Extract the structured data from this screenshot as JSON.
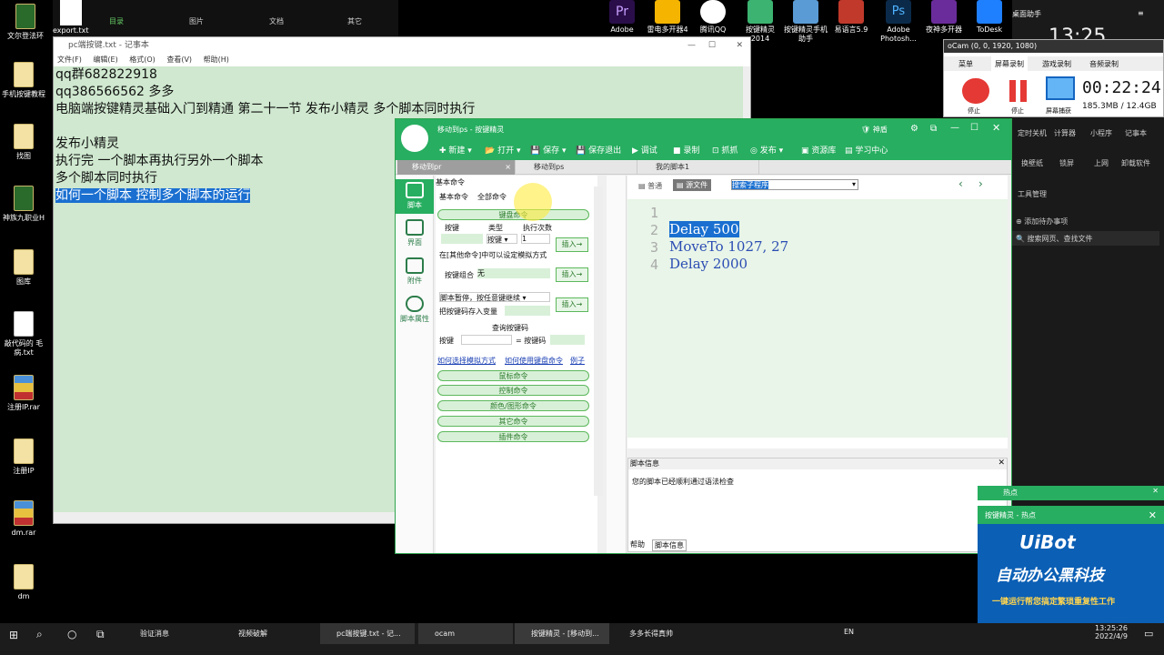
{
  "desktop": {
    "top_labels": [
      "目录",
      "图片",
      "文档",
      "其它"
    ],
    "export_file": "export.txt",
    "left_icons": [
      "文尔登法环",
      "手机按键教程",
      "找图",
      "神族九职业H",
      "图库",
      "敲代码的 毛病.txt",
      "注册IP.rar",
      "注册IP",
      "dm.rar",
      "dm"
    ],
    "top_apps": [
      "Adobe",
      "雷电多开器4",
      "腾讯QQ",
      "按键精灵 2014",
      "按键精灵手机 助手",
      "易语言5.9",
      "Adobe Photosh...",
      "夜神多开器",
      "ToDesk"
    ]
  },
  "notepad": {
    "title": "pc端按键.txt - 记事本",
    "menu": [
      "文件(F)",
      "编辑(E)",
      "格式(O)",
      "查看(V)",
      "帮助(H)"
    ],
    "lines": [
      "qq群682822918",
      "qq386566562 多多",
      "电脑端按键精灵基础入门到精通 第二十一节   发布小精灵   多个脚本同时执行",
      "",
      "发布小精灵",
      "执行完 一个脚本再执行另外一个脚本",
      "多个脚本同时执行"
    ],
    "selected_line": "如何一个脚本 控制多个脚本的运行"
  },
  "wizard": {
    "title": "移动到ps - 按键精灵",
    "vip": "神盾",
    "toolbar": [
      "新建",
      "打开",
      "保存",
      "保存退出",
      "调试",
      "录制",
      "抓抓",
      "发布",
      "资源库",
      "学习中心"
    ],
    "tabs": [
      "移动到pr",
      "移动到ps",
      "我的脚本1"
    ],
    "nav": [
      "脚本",
      "界面",
      "附件",
      "脚本属性"
    ],
    "panel_title": "基本命令",
    "subtabs": [
      "基本命令",
      "全部命令"
    ],
    "keyboard_cmd": "键盘命令",
    "col_headers": [
      "按键",
      "类型",
      "执行次数"
    ],
    "type_value": "按键",
    "count_value": "1",
    "insert": "插入→",
    "mode_hint": "在[其他命令]中可以设定模拟方式",
    "combo_label": "按键组合",
    "combo_value": "无",
    "pause_label": "脚本暂停，按任意键继续",
    "store_label": "把按键码存入变量",
    "query_label": "查询按键码",
    "key_label": "按键",
    "keycode_label": "= 按键码",
    "links": [
      "如何选择模拟方式",
      "如何使用键盘命令",
      "例子"
    ],
    "groups": [
      "鼠标命令",
      "控制命令",
      "颜色/图形命令",
      "其它命令",
      "插件命令"
    ],
    "view_modes": [
      "普通",
      "源文件"
    ],
    "search": "搜索子程序",
    "code": [
      "Delay 500",
      "MoveTo 1027, 27",
      "Delay 2000"
    ],
    "line_numbers": [
      "1",
      "2",
      "3",
      "4"
    ],
    "info_title": "脚本信息",
    "info_text": "您的脚本已经顺利通过语法检查",
    "bottom_tabs": [
      "帮助",
      "脚本信息"
    ]
  },
  "ocam": {
    "title": "oCam (0, 0, 1920, 1080)",
    "tabs": [
      "菜单",
      "屏幕录制",
      "游戏录制",
      "音频录制"
    ],
    "buttons": [
      "停止",
      "停止",
      "屏幕捕获"
    ],
    "time": "00:22:24",
    "size": "185.3MB / 12.4GB"
  },
  "sidepanel": {
    "title": "桌面助手",
    "clock": "13:25",
    "tools": [
      "定时关机",
      "计算器",
      "小程序",
      "记事本",
      "换壁纸",
      "锁屏",
      "上网",
      "卸载软件",
      "工具管理"
    ],
    "todo": "添加待办事项",
    "search": "搜索网页、查找文件",
    "hot_title": "热点"
  },
  "hot": {
    "title": "按键精灵 - 热点",
    "brand": "UiBot",
    "headline": "自动办公黑科技",
    "sub": "一键运行帮您搞定繁琐重复性工作"
  },
  "taskbar": {
    "items": [
      "验证消息",
      "视频破解",
      "pc端按键.txt - 记...",
      "ocam",
      "按键精灵 - [移动到...",
      "多多长得真帅"
    ],
    "lang": "EN",
    "time": "13:25:26",
    "date": "2022/4/9"
  }
}
